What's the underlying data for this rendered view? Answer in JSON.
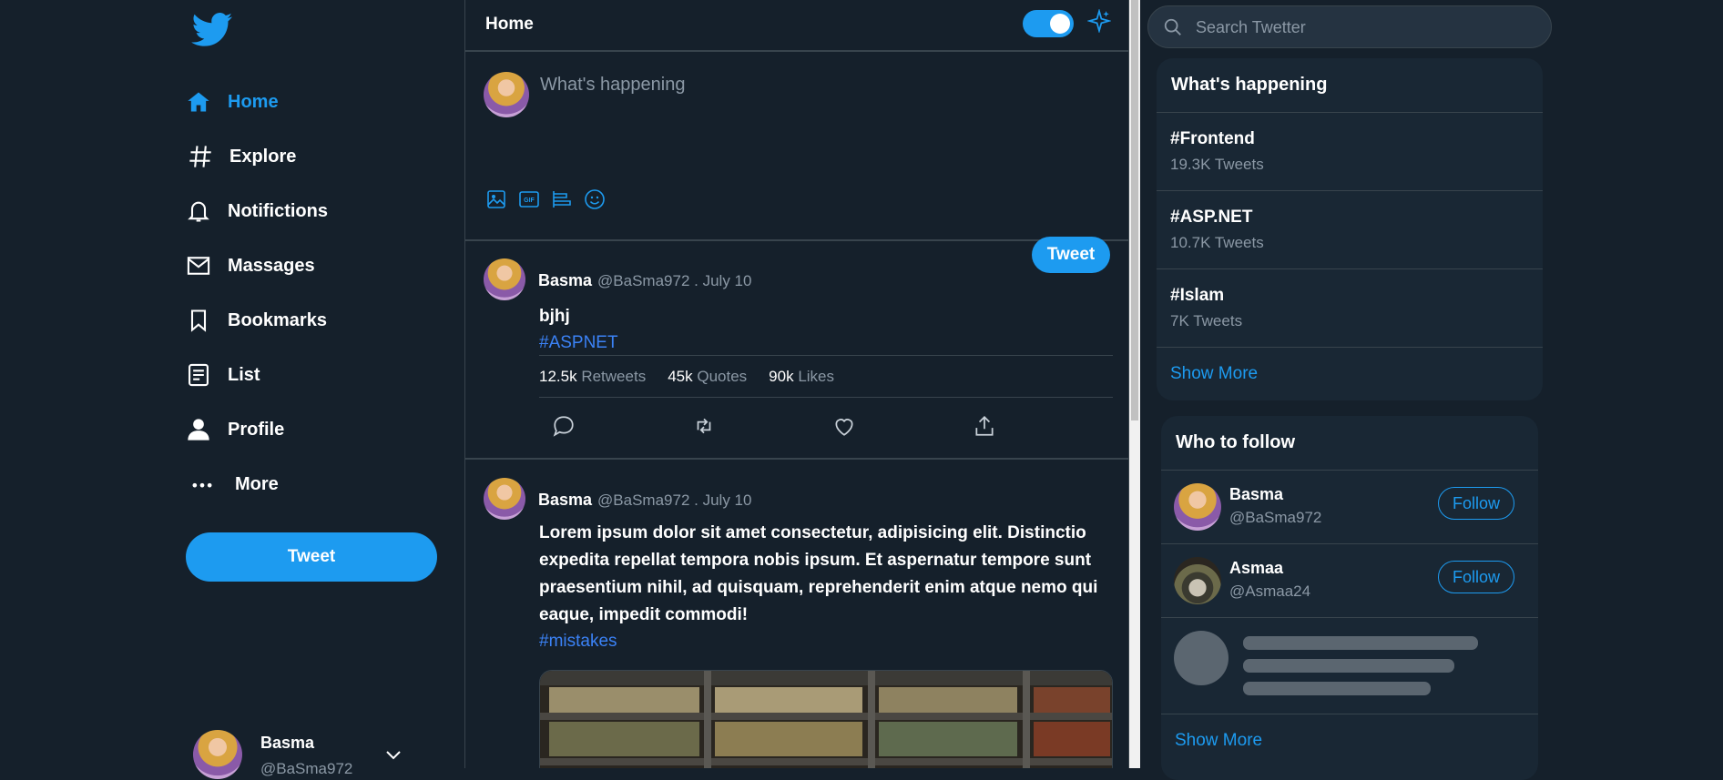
{
  "nav": {
    "items": [
      {
        "label": "Home",
        "icon": "home-icon"
      },
      {
        "label": "Explore",
        "icon": "hash-icon"
      },
      {
        "label": "Notifictions",
        "icon": "bell-icon"
      },
      {
        "label": "Massages",
        "icon": "mail-icon"
      },
      {
        "label": "Bookmarks",
        "icon": "bookmark-icon"
      },
      {
        "label": "List",
        "icon": "list-icon"
      },
      {
        "label": "Profile",
        "icon": "user-icon"
      },
      {
        "label": "More",
        "icon": "more-icon"
      }
    ],
    "tweet_button": "Tweet",
    "user": {
      "name": "Basma",
      "handle": "@BaSma972"
    }
  },
  "center": {
    "title": "Home",
    "compose_placeholder": "What's happening",
    "tweet_button": "Tweet",
    "posts": [
      {
        "name": "Basma",
        "meta": "@BaSma972 . July 10",
        "text": "bjhj",
        "hashtag": "#ASPNET",
        "retweets": "12.5k",
        "retweets_label": "Retweets",
        "quotes": "45k",
        "quotes_label": "Quotes",
        "likes": "90k",
        "likes_label": "Likes"
      },
      {
        "name": "Basma",
        "meta": "@BaSma972 . July 10",
        "text": "Lorem ipsum dolor sit amet consectetur, adipisicing elit. Distinctio expedita repellat tempora nobis ipsum. Et aspernatur tempore sunt praesentium nihil, ad quisquam, reprehenderit enim atque nemo qui eaque, impedit commodi!",
        "hashtag": "#mistakes"
      }
    ]
  },
  "right": {
    "search_placeholder": "Search Twetter",
    "trending": {
      "title": "What's happening",
      "items": [
        {
          "tag": "#Frontend",
          "count": "19.3K Tweets"
        },
        {
          "tag": "#ASP.NET",
          "count": "10.7K Tweets"
        },
        {
          "tag": "#Islam",
          "count": "7K Tweets"
        }
      ],
      "show_more": "Show More"
    },
    "follow": {
      "title": "Who to follow",
      "users": [
        {
          "name": "Basma",
          "handle": "@BaSma972",
          "button": "Follow"
        },
        {
          "name": "Asmaa",
          "handle": "@Asmaa24",
          "button": "Follow"
        }
      ],
      "show_more": "Show More"
    }
  },
  "colors": {
    "accent": "#1d9bf0",
    "background": "#15202b",
    "panel": "#192734"
  }
}
